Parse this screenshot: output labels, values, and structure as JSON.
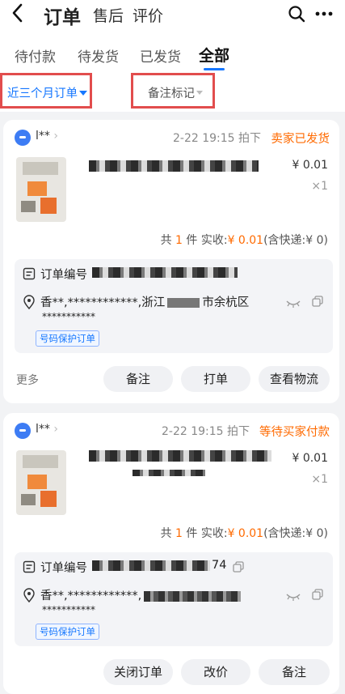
{
  "header": {
    "title": "订单",
    "sub1": "售后",
    "sub2": "评价"
  },
  "tabs": [
    "待付款",
    "待发货",
    "已发货",
    "全部"
  ],
  "filters": {
    "period": "近三个月订单",
    "note_mark": "备注标记"
  },
  "orders": [
    {
      "user": "l**",
      "time": "2-22 19:15 拍下",
      "status": "卖家已发货",
      "price": "¥ 0.01",
      "qty": "×1",
      "summary_prefix": "共",
      "count": "1",
      "summary_mid": "件 实收:",
      "amount": "¥ 0.01",
      "summary_suffix": "(含快递:¥ 0)",
      "order_label": "订单编号",
      "address_prefix": "香**,************,",
      "address_tail": "浙江",
      "address_tail2": "市余杭区",
      "phone_mask": "***********",
      "tag": "号码保护订单",
      "more": "更多",
      "buttons": [
        "备注",
        "打单",
        "查看物流"
      ]
    },
    {
      "user": "l**",
      "time": "2-22 19:15 拍下",
      "status": "等待买家付款",
      "price": "¥ 0.01",
      "qty": "×1",
      "summary_prefix": "共",
      "count": "1",
      "summary_mid": "件 实收:",
      "amount": "¥ 0.01",
      "summary_suffix": "(含快递:¥ 0)",
      "order_label": "订单编号",
      "order_tail": "74",
      "address_prefix": "香**,************,",
      "phone_mask": "***********",
      "tag": "号码保护订单",
      "buttons": [
        "关闭订单",
        "改价",
        "备注"
      ]
    }
  ]
}
